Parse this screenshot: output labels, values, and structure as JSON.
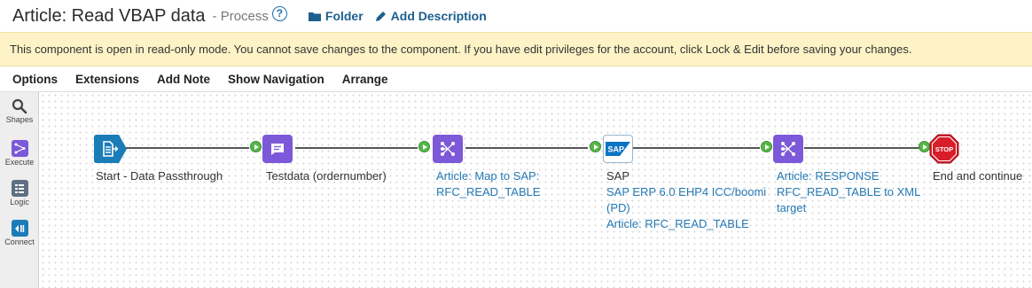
{
  "header": {
    "title": "Article: Read VBAP data",
    "subtitle": "- Process",
    "help_glyph": "?",
    "folder_label": "Folder",
    "add_description_label": "Add Description"
  },
  "banner": {
    "message": "This component is open in read-only mode. You cannot save changes to the component. If you have edit privileges for the account, click Lock & Edit before saving your changes."
  },
  "menu": {
    "options": "Options",
    "extensions": "Extensions",
    "add_note": "Add Note",
    "show_navigation": "Show Navigation",
    "arrange": "Arrange"
  },
  "palette": {
    "shapes": "Shapes",
    "execute": "Execute",
    "logic": "Logic",
    "connect": "Connect"
  },
  "shapes": {
    "start": {
      "title": "Start - Data Passthrough"
    },
    "message": {
      "title": "Testdata (ordernumber)"
    },
    "map1": {
      "line1": "Article: Map to SAP:",
      "line2": "RFC_READ_TABLE"
    },
    "sap": {
      "logo_text": "SAP",
      "title": "SAP",
      "line1": "SAP ERP 6.0 EHP4 ICC/boomi",
      "line2": "(PD)",
      "line3": "Article: RFC_READ_TABLE"
    },
    "map2": {
      "line1": "Article: RESPONSE",
      "line2": "RFC_READ_TABLE to XML",
      "line3": "target"
    },
    "stop": {
      "sign_text": "STOP",
      "title": "End and continue"
    }
  },
  "colors": {
    "accent_link": "#1d5f8f",
    "banner_bg": "#fdf3c6",
    "map_shape": "#7b59d8",
    "start_shape": "#1b7cb8",
    "connector_dot": "#54b846",
    "stop_red": "#d81e2a"
  }
}
